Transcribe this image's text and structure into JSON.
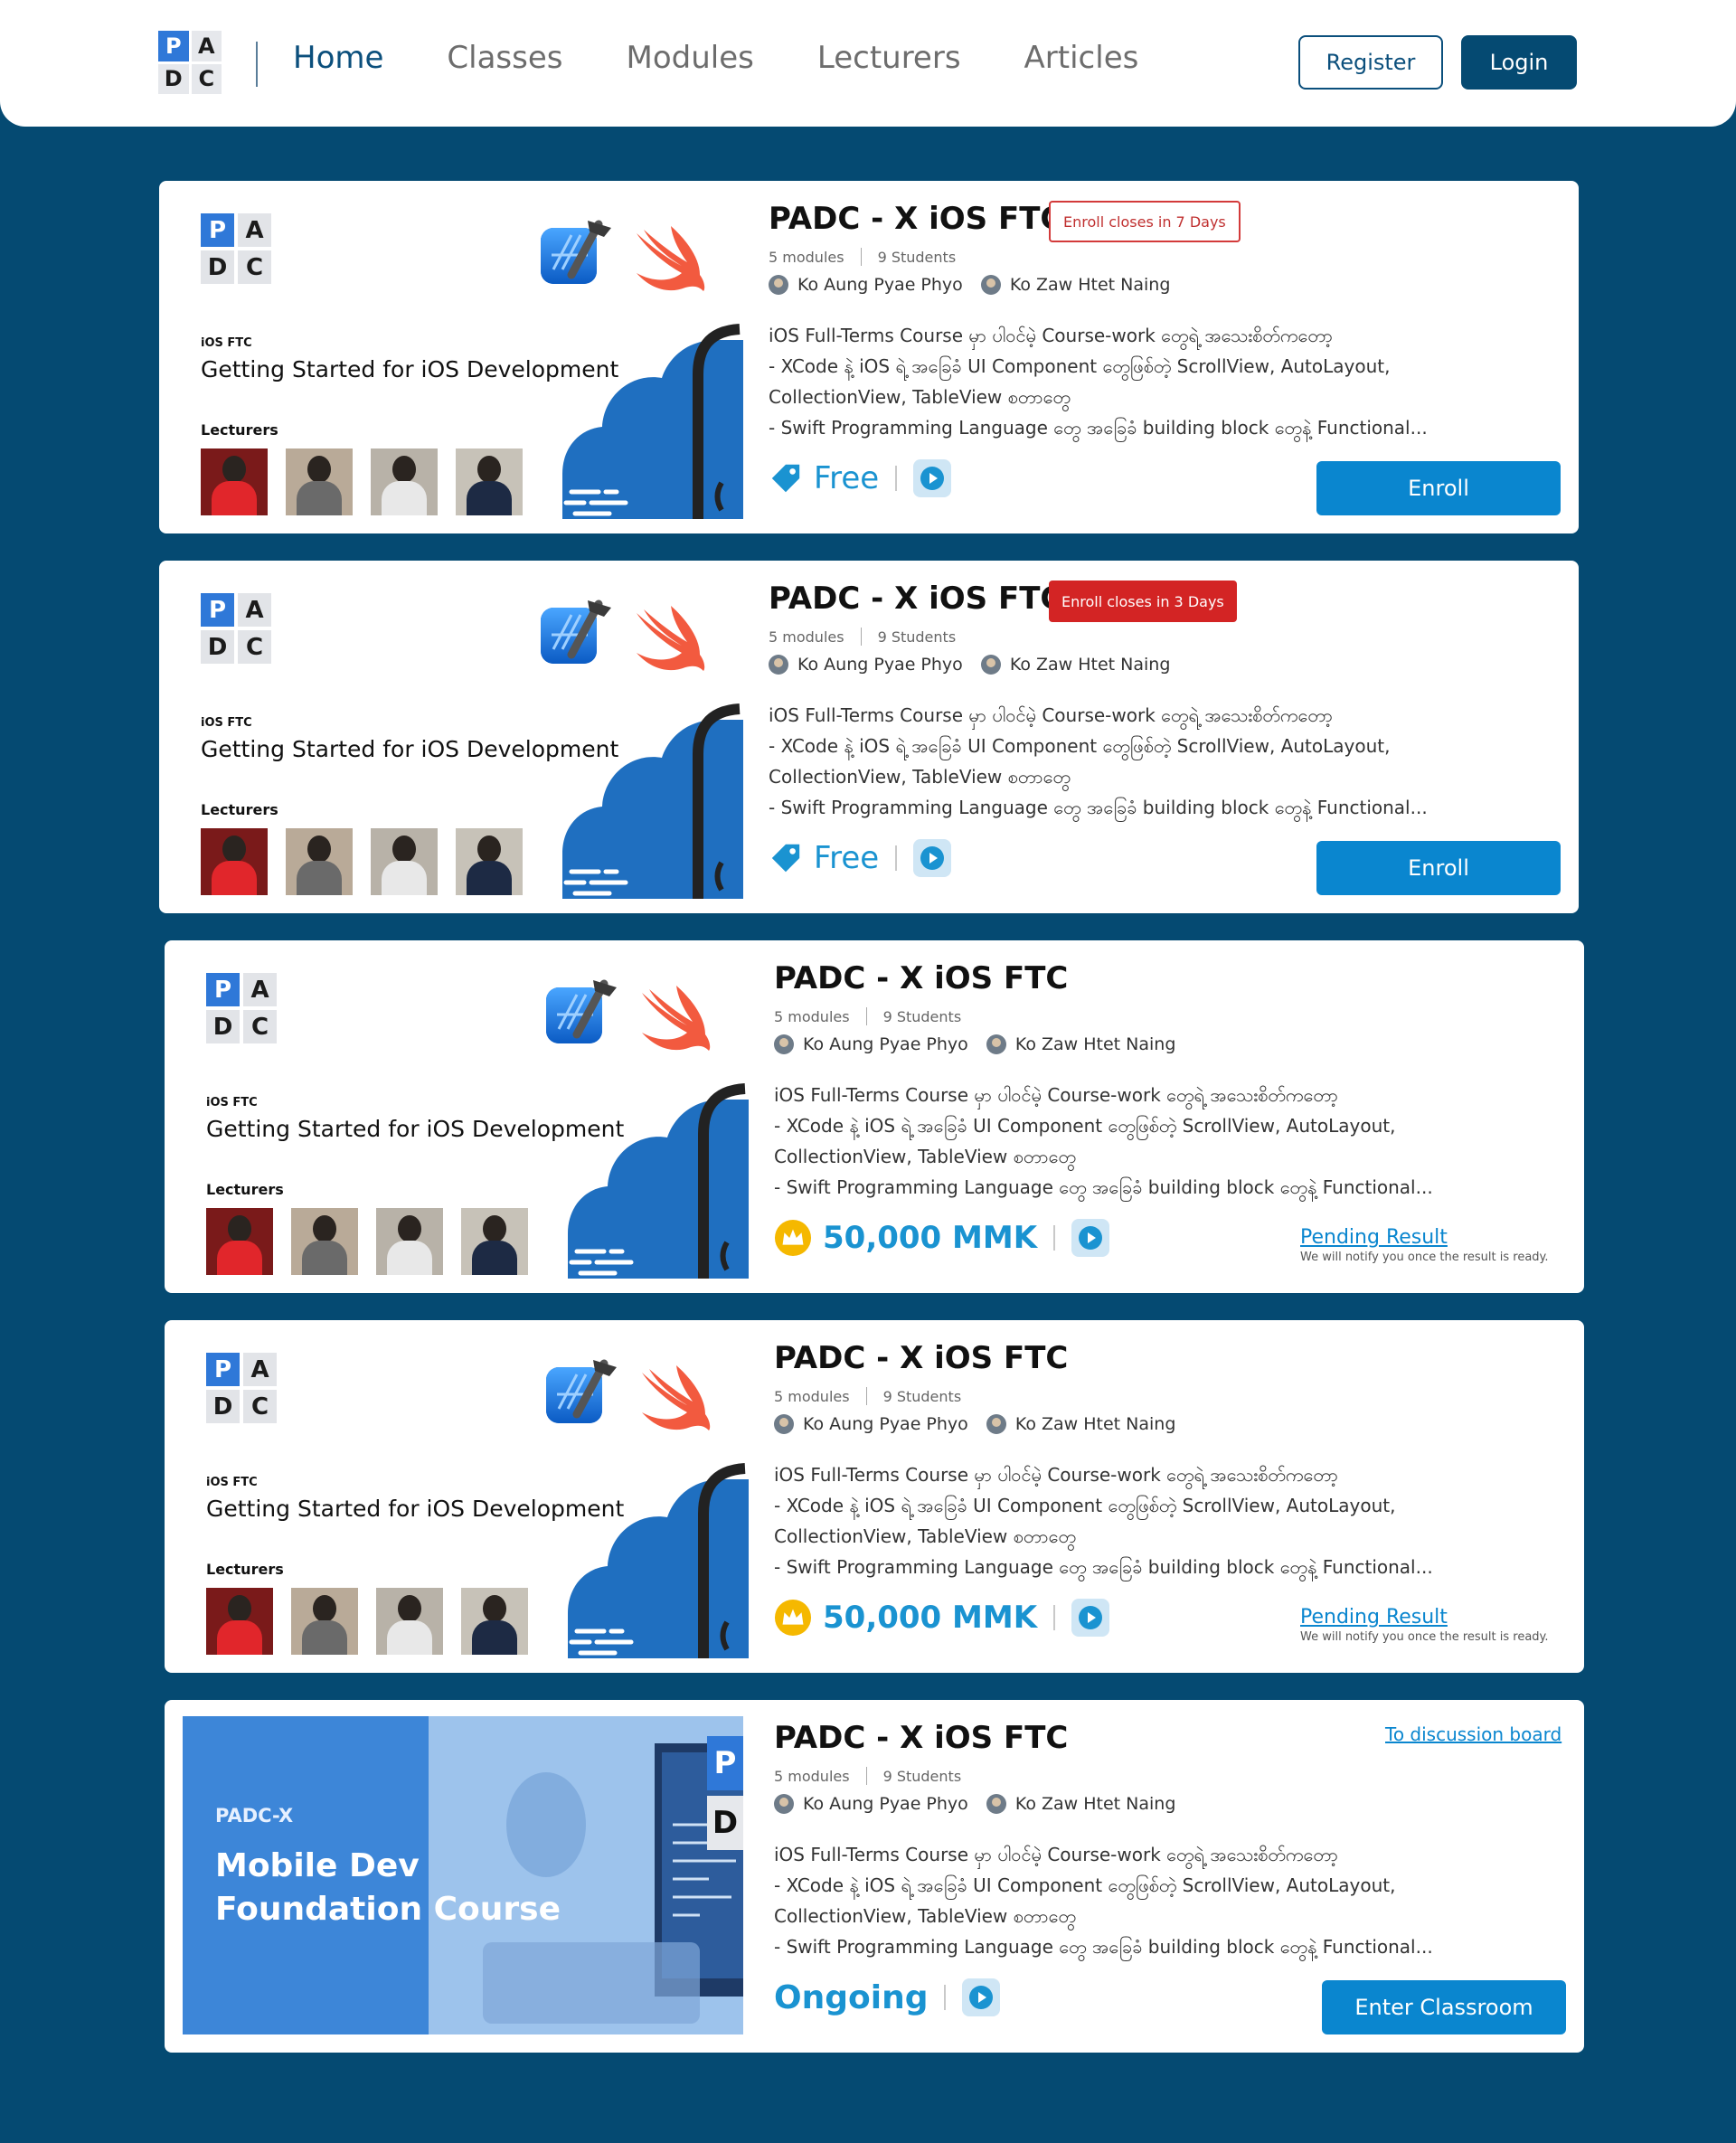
{
  "nav": {
    "logo": [
      "P",
      "A",
      "D",
      "C"
    ],
    "links": [
      "Home",
      "Classes",
      "Modules",
      "Lecturers",
      "Articles"
    ],
    "active": "Home",
    "register": "Register",
    "login": "Login"
  },
  "thumb": {
    "logo": [
      "P",
      "A",
      "D",
      "C"
    ],
    "small_label": "iOS FTC",
    "title": "Getting Started for iOS Development",
    "lecturers_label": "Lecturers"
  },
  "foundation_thumb": {
    "label": "PADC-X",
    "title_line1": "Mobile Dev",
    "title_line2": "Foundation Course",
    "logo": [
      "P",
      "D"
    ]
  },
  "colors": {
    "background": "#054a72",
    "accent": "#0a86cf",
    "badge_red": "#d32424"
  },
  "cards": [
    {
      "title": "PADC - X iOS FTC",
      "badge": "Enroll closes in 7 Days",
      "modules": "5 modules",
      "students": "9 Students",
      "lecturer1": "Ko Aung Pyae Phyo",
      "lecturer2": "Ko Zaw Htet Naing",
      "desc1": "iOS  Full-Terms  Course  မှာ  ပါဝင်မဲ့  Course-work  တွေရဲ့  အသေးစိတ်ကတော့",
      "desc2": "-  XCode  နဲ့  iOS  ရဲ့  အခြေခံ  UI  Component  တွေဖြစ်တဲ့  ScrollView,  AutoLayout,",
      "desc3": "CollectionView,  TableView  စတာတွေ",
      "desc4": "-  Swift  Programming  Language  တွေ  အခြေခံ  building  block  တွေနဲ့  Functional...",
      "price": "Free",
      "action": "Enroll"
    },
    {
      "title": "PADC - X iOS FTC",
      "badge": "Enroll closes in 3 Days",
      "modules": "5 modules",
      "students": "9 Students",
      "lecturer1": "Ko Aung Pyae Phyo",
      "lecturer2": "Ko Zaw Htet Naing",
      "desc1": "iOS  Full-Terms  Course  မှာ  ပါဝင်မဲ့  Course-work  တွေရဲ့  အသေးစိတ်ကတော့",
      "desc2": "-  XCode  နဲ့  iOS  ရဲ့  အခြေခံ  UI  Component  တွေဖြစ်တဲ့  ScrollView,  AutoLayout,",
      "desc3": "CollectionView,  TableView  စတာတွေ",
      "desc4": "-  Swift  Programming  Language  တွေ  အခြေခံ  building  block  တွေနဲ့  Functional...",
      "price": "Free",
      "action": "Enroll"
    },
    {
      "title": "PADC - X iOS FTC",
      "modules": "5 modules",
      "students": "9 Students",
      "lecturer1": "Ko Aung Pyae Phyo",
      "lecturer2": "Ko Zaw Htet Naing",
      "desc1": "iOS  Full-Terms  Course  မှာ  ပါဝင်မဲ့  Course-work  တွေရဲ့  အသေးစိတ်ကတော့",
      "desc2": "-  XCode  နဲ့  iOS  ရဲ့  အခြေခံ  UI  Component  တွေဖြစ်တဲ့  ScrollView,  AutoLayout,",
      "desc3": "CollectionView,  TableView  စတာတွေ",
      "desc4": "-  Swift  Programming  Language  တွေ  အခြေခံ  building  block  တွေနဲ့  Functional...",
      "price": "50,000 MMK",
      "pending": "Pending Result",
      "pending_note": "We will notify you once the result is ready."
    },
    {
      "title": "PADC - X iOS FTC",
      "modules": "5 modules",
      "students": "9 Students",
      "lecturer1": "Ko Aung Pyae Phyo",
      "lecturer2": "Ko Zaw Htet Naing",
      "desc1": "iOS  Full-Terms  Course  မှာ  ပါဝင်မဲ့  Course-work  တွေရဲ့  အသေးစိတ်ကတော့",
      "desc2": "-  XCode  နဲ့  iOS  ရဲ့  အခြေခံ  UI  Component  တွေဖြစ်တဲ့  ScrollView,  AutoLayout,",
      "desc3": "CollectionView,  TableView  စတာတွေ",
      "desc4": "-  Swift  Programming  Language  တွေ  အခြေခံ  building  block  တွေနဲ့  Functional...",
      "price": "50,000 MMK",
      "pending": "Pending Result",
      "pending_note": "We will notify you once the result is ready."
    },
    {
      "title": "PADC - X iOS FTC",
      "discussion": "To discussion board",
      "modules": "5 modules",
      "students": "9 Students",
      "lecturer1": "Ko Aung Pyae Phyo",
      "lecturer2": "Ko Zaw Htet Naing",
      "desc1": "iOS  Full-Terms  Course  မှာ  ပါဝင်မဲ့  Course-work  တွေရဲ့  အသေးစိတ်ကတော့",
      "desc2": "-  XCode  နဲ့  iOS  ရဲ့  အခြေခံ  UI  Component  တွေဖြစ်တဲ့  ScrollView,  AutoLayout,",
      "desc3": "CollectionView,  TableView  စတာတွေ",
      "desc4": "-  Swift  Programming  Language  တွေ  အခြေခံ  building  block  တွေနဲ့  Functional...",
      "status": "Ongoing",
      "action": "Enter Classroom"
    }
  ]
}
